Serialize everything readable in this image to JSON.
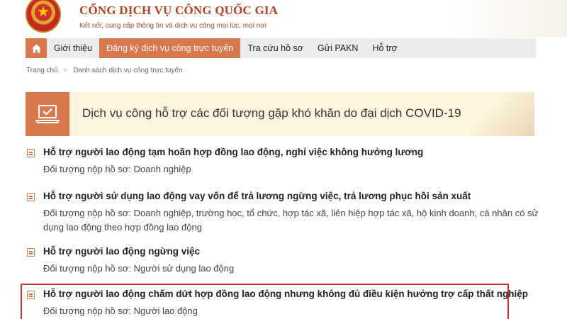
{
  "header": {
    "site_title": "CỔNG DỊCH VỤ CÔNG QUỐC GIA",
    "tagline": "Kết nối, cung cấp thông tin và dịch vụ công mọi lúc, mọi nơi"
  },
  "nav": {
    "home_icon": "home-icon",
    "items": [
      {
        "label": "Giới thiệu"
      },
      {
        "label": "Đăng ký dịch vụ công trực tuyến"
      },
      {
        "label": "Tra cứu hồ sơ"
      },
      {
        "label": "Gửi PAKN"
      },
      {
        "label": "Hỗ trợ"
      }
    ],
    "active_index": 1
  },
  "breadcrumb": {
    "items": [
      "Trang chủ",
      "Danh sách dịch vụ công trực tuyến"
    ],
    "separator": ">"
  },
  "banner": {
    "icon": "laptop-check-icon",
    "title": "Dịch vụ công hỗ trợ các đối tượng gặp khó khăn do đại dịch COVID-19"
  },
  "services": [
    {
      "title": "Hỗ trợ người lao động tạm hoãn hợp đồng lao động, nghỉ việc không hưởng lương",
      "subject": "Đối tượng nộp hồ sơ: Doanh nghiệp"
    },
    {
      "title": "Hỗ trợ người sử dụng lao động vay vốn để trả lương ngừng việc, trả lương phục hồi sản xuất",
      "subject": "Đối tượng nộp hồ sơ: Doanh nghiệp, trường học, tổ chức, hợp tác xã, liên hiệp hợp tác xã, hộ kinh doanh, cá nhân có sử dụng lao động theo hợp đồng lao động"
    },
    {
      "title": "Hỗ trợ người lao động ngừng việc",
      "subject": "Đối tượng nộp hồ sơ: Người sử dụng lao động"
    },
    {
      "title": "Hỗ trợ người lao động chấm dứt hợp đồng lao động nhưng không đủ điều kiện hưởng trợ cấp thất nghiệp",
      "subject": "Đối tượng nộp hồ sơ: Người lao động"
    }
  ],
  "colors": {
    "accent": "#d9774f",
    "brand_title": "#b3401f",
    "banner_bg": "#fcf4dd",
    "nav_bg": "#ececec",
    "highlight": "#d32f2f"
  }
}
